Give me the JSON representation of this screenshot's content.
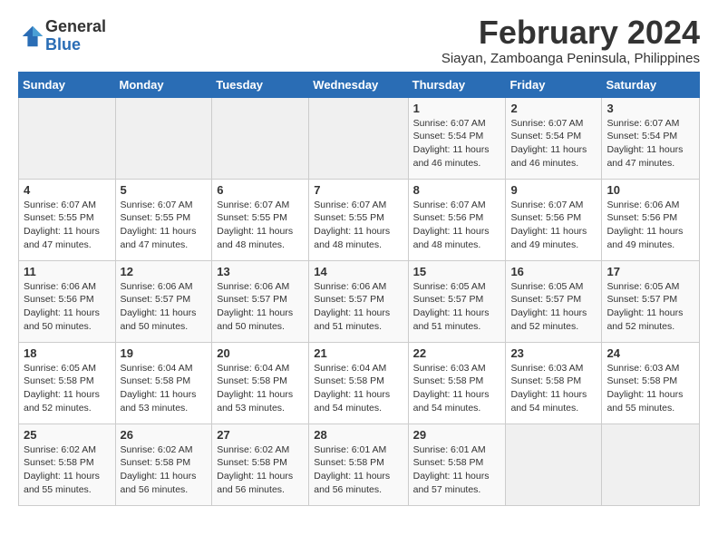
{
  "logo": {
    "general": "General",
    "blue": "Blue"
  },
  "title": {
    "month_year": "February 2024",
    "location": "Siayan, Zamboanga Peninsula, Philippines"
  },
  "headers": [
    "Sunday",
    "Monday",
    "Tuesday",
    "Wednesday",
    "Thursday",
    "Friday",
    "Saturday"
  ],
  "weeks": [
    [
      {
        "day": "",
        "info": ""
      },
      {
        "day": "",
        "info": ""
      },
      {
        "day": "",
        "info": ""
      },
      {
        "day": "",
        "info": ""
      },
      {
        "day": "1",
        "info": "Sunrise: 6:07 AM\nSunset: 5:54 PM\nDaylight: 11 hours\nand 46 minutes."
      },
      {
        "day": "2",
        "info": "Sunrise: 6:07 AM\nSunset: 5:54 PM\nDaylight: 11 hours\nand 46 minutes."
      },
      {
        "day": "3",
        "info": "Sunrise: 6:07 AM\nSunset: 5:54 PM\nDaylight: 11 hours\nand 47 minutes."
      }
    ],
    [
      {
        "day": "4",
        "info": "Sunrise: 6:07 AM\nSunset: 5:55 PM\nDaylight: 11 hours\nand 47 minutes."
      },
      {
        "day": "5",
        "info": "Sunrise: 6:07 AM\nSunset: 5:55 PM\nDaylight: 11 hours\nand 47 minutes."
      },
      {
        "day": "6",
        "info": "Sunrise: 6:07 AM\nSunset: 5:55 PM\nDaylight: 11 hours\nand 48 minutes."
      },
      {
        "day": "7",
        "info": "Sunrise: 6:07 AM\nSunset: 5:55 PM\nDaylight: 11 hours\nand 48 minutes."
      },
      {
        "day": "8",
        "info": "Sunrise: 6:07 AM\nSunset: 5:56 PM\nDaylight: 11 hours\nand 48 minutes."
      },
      {
        "day": "9",
        "info": "Sunrise: 6:07 AM\nSunset: 5:56 PM\nDaylight: 11 hours\nand 49 minutes."
      },
      {
        "day": "10",
        "info": "Sunrise: 6:06 AM\nSunset: 5:56 PM\nDaylight: 11 hours\nand 49 minutes."
      }
    ],
    [
      {
        "day": "11",
        "info": "Sunrise: 6:06 AM\nSunset: 5:56 PM\nDaylight: 11 hours\nand 50 minutes."
      },
      {
        "day": "12",
        "info": "Sunrise: 6:06 AM\nSunset: 5:57 PM\nDaylight: 11 hours\nand 50 minutes."
      },
      {
        "day": "13",
        "info": "Sunrise: 6:06 AM\nSunset: 5:57 PM\nDaylight: 11 hours\nand 50 minutes."
      },
      {
        "day": "14",
        "info": "Sunrise: 6:06 AM\nSunset: 5:57 PM\nDaylight: 11 hours\nand 51 minutes."
      },
      {
        "day": "15",
        "info": "Sunrise: 6:05 AM\nSunset: 5:57 PM\nDaylight: 11 hours\nand 51 minutes."
      },
      {
        "day": "16",
        "info": "Sunrise: 6:05 AM\nSunset: 5:57 PM\nDaylight: 11 hours\nand 52 minutes."
      },
      {
        "day": "17",
        "info": "Sunrise: 6:05 AM\nSunset: 5:57 PM\nDaylight: 11 hours\nand 52 minutes."
      }
    ],
    [
      {
        "day": "18",
        "info": "Sunrise: 6:05 AM\nSunset: 5:58 PM\nDaylight: 11 hours\nand 52 minutes."
      },
      {
        "day": "19",
        "info": "Sunrise: 6:04 AM\nSunset: 5:58 PM\nDaylight: 11 hours\nand 53 minutes."
      },
      {
        "day": "20",
        "info": "Sunrise: 6:04 AM\nSunset: 5:58 PM\nDaylight: 11 hours\nand 53 minutes."
      },
      {
        "day": "21",
        "info": "Sunrise: 6:04 AM\nSunset: 5:58 PM\nDaylight: 11 hours\nand 54 minutes."
      },
      {
        "day": "22",
        "info": "Sunrise: 6:03 AM\nSunset: 5:58 PM\nDaylight: 11 hours\nand 54 minutes."
      },
      {
        "day": "23",
        "info": "Sunrise: 6:03 AM\nSunset: 5:58 PM\nDaylight: 11 hours\nand 54 minutes."
      },
      {
        "day": "24",
        "info": "Sunrise: 6:03 AM\nSunset: 5:58 PM\nDaylight: 11 hours\nand 55 minutes."
      }
    ],
    [
      {
        "day": "25",
        "info": "Sunrise: 6:02 AM\nSunset: 5:58 PM\nDaylight: 11 hours\nand 55 minutes."
      },
      {
        "day": "26",
        "info": "Sunrise: 6:02 AM\nSunset: 5:58 PM\nDaylight: 11 hours\nand 56 minutes."
      },
      {
        "day": "27",
        "info": "Sunrise: 6:02 AM\nSunset: 5:58 PM\nDaylight: 11 hours\nand 56 minutes."
      },
      {
        "day": "28",
        "info": "Sunrise: 6:01 AM\nSunset: 5:58 PM\nDaylight: 11 hours\nand 56 minutes."
      },
      {
        "day": "29",
        "info": "Sunrise: 6:01 AM\nSunset: 5:58 PM\nDaylight: 11 hours\nand 57 minutes."
      },
      {
        "day": "",
        "info": ""
      },
      {
        "day": "",
        "info": ""
      }
    ]
  ]
}
